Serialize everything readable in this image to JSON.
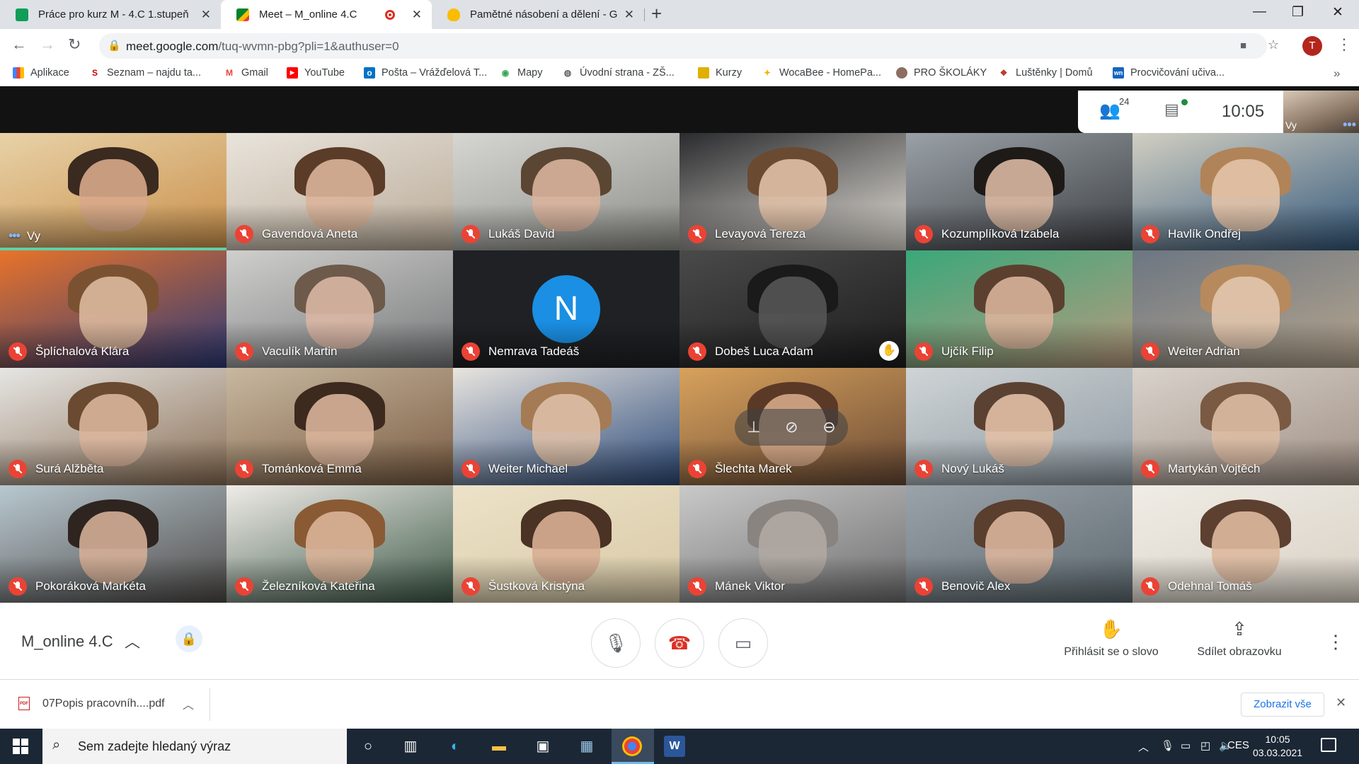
{
  "browser": {
    "tabs": [
      {
        "title": "Práce pro kurz M - 4.C 1.stupeň",
        "favicon_color": "#0f9d58"
      },
      {
        "title": "Meet – M_online 4.C",
        "favicon_color": "#00832d",
        "active": true,
        "recording": true
      },
      {
        "title": "Pamětné násobení a dělení - Goo",
        "favicon_color": "#fbbc04"
      }
    ],
    "new_tab": "+",
    "window_controls": {
      "minimize": "—",
      "maximize": "❐",
      "close": "✕"
    },
    "address": {
      "host": "meet.google.com",
      "path": "/tuq-wvmn-pbg?pli=1&authuser=0"
    },
    "profile_initial": "T",
    "bookmarks": [
      {
        "label": "Aplikace",
        "icon": "apps-grid-icon",
        "color": "#4285f4"
      },
      {
        "label": "Seznam – najdu ta...",
        "icon": "seznam-icon",
        "color": "#cc0000"
      },
      {
        "label": "Gmail",
        "icon": "gmail-icon",
        "color": "#ea4335"
      },
      {
        "label": "YouTube",
        "icon": "youtube-icon",
        "color": "#ff0000"
      },
      {
        "label": "Pošta – Vrážďelová T...",
        "icon": "outlook-icon",
        "color": "#0072c6"
      },
      {
        "label": "Mapy",
        "icon": "maps-icon",
        "color": "#34a853"
      },
      {
        "label": "Úvodní strana - ZŠ...",
        "icon": "globe-icon",
        "color": "#5f6368"
      },
      {
        "label": "Kurzy",
        "icon": "kurzy-icon",
        "color": "#e0b000"
      },
      {
        "label": "WocaBee - HomePa...",
        "icon": "wocabee-icon",
        "color": "#f4b400"
      },
      {
        "label": "PRO ŠKOLÁKY",
        "icon": "skolaky-icon",
        "color": "#8d6e63"
      },
      {
        "label": "Luštěnky | Domů",
        "icon": "lustenky-icon",
        "color": "#c0392b"
      },
      {
        "label": "Procvičování učiva...",
        "icon": "wn-icon",
        "color": "#1565c0"
      }
    ]
  },
  "meet": {
    "participants_count": "24",
    "time": "10:05",
    "self_label": "Vy",
    "meeting_name": "M_online 4.C",
    "hover_controls": [
      "pin-icon",
      "mute-icon",
      "remove-icon"
    ],
    "participants": [
      {
        "name": "Vy",
        "self": true,
        "c1": "#e8d2a8",
        "c2": "#c98f4a",
        "skin": "#d7a98a",
        "hair": "#3a2a20"
      },
      {
        "name": "Gavendová Aneta",
        "c1": "#e9e4dc",
        "c2": "#b9aa97",
        "skin": "#d9b49a",
        "hair": "#5a3c28"
      },
      {
        "name": "Lukáš David",
        "c1": "#d6d6d3",
        "c2": "#8d8d88",
        "skin": "#d8b39c",
        "hair": "#5b4634"
      },
      {
        "name": "Levayová Tereza",
        "c1": "#2a2b2e",
        "c2": "#e4e0d8",
        "skin": "#e0c0a6",
        "hair": "#6b4a32"
      },
      {
        "name": "Kozumplíková Izabela",
        "c1": "#9aa1a6",
        "c2": "#3c3f44",
        "skin": "#d9b8a2",
        "hair": "#1e1a18"
      },
      {
        "name": "Havlík Ondřej",
        "c1": "#d2cfc2",
        "c2": "#35597c",
        "skin": "#e3c3a9",
        "hair": "#b08458"
      },
      {
        "name": "Šplíchalová Klára",
        "c1": "#e8732a",
        "c2": "#2e3a78",
        "skin": "#dcb89c",
        "hair": "#7a5232"
      },
      {
        "name": "Vaculík Martin",
        "c1": "#cfcfcd",
        "c2": "#77787a",
        "skin": "#d9b6a4",
        "hair": "#6e5a4a"
      },
      {
        "name": "Nemrava Tadeáš",
        "avatar": "N",
        "c1": "#202124",
        "c2": "#202124"
      },
      {
        "name": "Dobeš Luca Adam",
        "hand_raised": true,
        "c1": "#4a4a4a",
        "c2": "#1c1c1c",
        "skin": "#555",
        "hair": "#1a1a1a"
      },
      {
        "name": "Ujčík Filip",
        "c1": "#3aa87a",
        "c2": "#b89a7e",
        "skin": "#d8b29a",
        "hair": "#5b4030"
      },
      {
        "name": "Weiter Adrian",
        "c1": "#6c7682",
        "c2": "#b5a58e",
        "skin": "#e1c5ad",
        "hair": "#b78a5e"
      },
      {
        "name": "Surá Alžběta",
        "c1": "#e6e6e4",
        "c2": "#8b6f55",
        "skin": "#d9b59c",
        "hair": "#6a4a30"
      },
      {
        "name": "Tománková Emma",
        "c1": "#c8b8a0",
        "c2": "#7a5c42",
        "skin": "#d8b29a",
        "hair": "#3d2a1e"
      },
      {
        "name": "Weiter Michael",
        "c1": "#e9e5df",
        "c2": "#2c4a7a",
        "skin": "#ddbfa6",
        "hair": "#a47b55"
      },
      {
        "name": "Šlechta Marek",
        "hover": true,
        "c1": "#d8a25c",
        "c2": "#6a4a36",
        "skin": "#d4a888",
        "hair": "#5a3a26"
      },
      {
        "name": "Nový Lukáš",
        "c1": "#cfd4d6",
        "c2": "#8e9aa2",
        "skin": "#e2c0a6",
        "hair": "#5b4132"
      },
      {
        "name": "Martykán Vojtěch",
        "c1": "#d9d3cc",
        "c2": "#9f8f84",
        "skin": "#dcbba3",
        "hair": "#7a5a42"
      },
      {
        "name": "Pokoráková Markéta",
        "c1": "#b8c8d0",
        "c2": "#4e4a48",
        "skin": "#d4ae96",
        "hair": "#2e2420"
      },
      {
        "name": "Železníková Kateřina",
        "c1": "#f0ece8",
        "c2": "#3e5a48",
        "skin": "#d9b398",
        "hair": "#8a5a34"
      },
      {
        "name": "Šustková Kristýna",
        "c1": "#ede2c8",
        "c2": "#d8c9a6",
        "skin": "#d8ae94",
        "hair": "#4a3224"
      },
      {
        "name": "Mánek Viktor",
        "c1": "#c9c9c9",
        "c2": "#6e6e70",
        "skin": "#b0a9a2",
        "hair": "#8a8480"
      },
      {
        "name": "Benovič Alex",
        "c1": "#9aa3a9",
        "c2": "#5e6a70",
        "skin": "#d9b49c",
        "hair": "#5a3e2e"
      },
      {
        "name": "Odehnal Tomáš",
        "c1": "#f0ede6",
        "c2": "#d8d0c4",
        "skin": "#ddb99e",
        "hair": "#5d4030"
      }
    ],
    "actions": {
      "raise_hand": "Přihlásit se o slovo",
      "present": "Sdílet obrazovku"
    }
  },
  "downloads": {
    "file": "07Popis pracovníh....pdf",
    "file_badge": "PDF",
    "show_all": "Zobrazit vše"
  },
  "taskbar": {
    "search_placeholder": "Sem zadejte hledaný výraz",
    "language": "CES",
    "time": "10:05",
    "date": "03.03.2021"
  }
}
